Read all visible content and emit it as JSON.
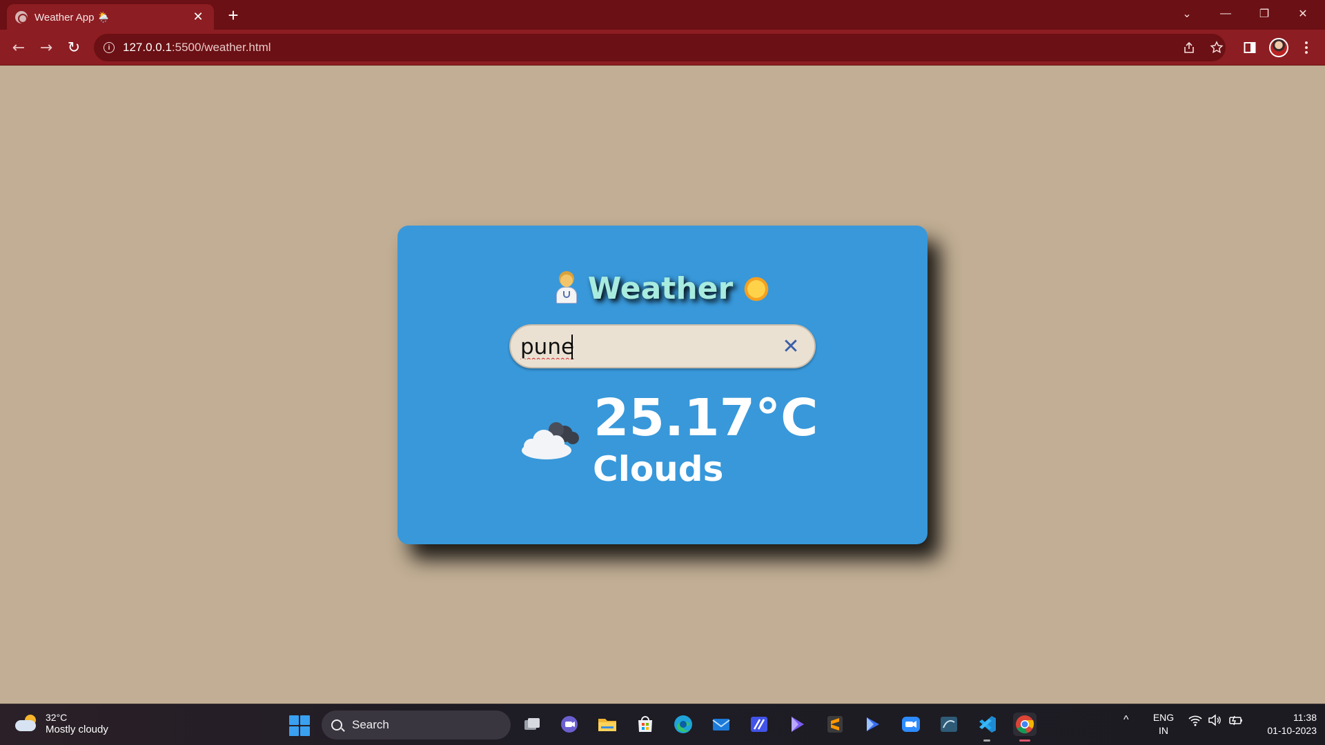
{
  "browser": {
    "tab_title": "Weather App 🌦️",
    "tab_close": "✕",
    "new_tab": "+",
    "url_host": "127.0.0.1",
    "url_path": ":5500/weather.html",
    "info_glyph": "i"
  },
  "window_controls": {
    "dropdown": "⌄",
    "minimize": "—",
    "restore": "❐",
    "close": "✕"
  },
  "nav": {
    "back": "←",
    "forward": "→",
    "reload": "↻"
  },
  "weather_app": {
    "title": "Weather",
    "search_value": "pune",
    "clear_glyph": "✕",
    "temperature": "25.17°C",
    "condition": "Clouds",
    "condition_icon": "cloud-icon"
  },
  "taskbar": {
    "weather_temp": "32°C",
    "weather_desc": "Mostly cloudy",
    "search_label": "Search",
    "lang_line1": "ENG",
    "lang_line2": "IN",
    "time": "11:38",
    "date": "01-10-2023",
    "tray_chevron": "^"
  },
  "colors": {
    "page_bg": "#c1ae94",
    "card_bg": "#3898da",
    "title_color": "#a8ebdf",
    "chrome_dark": "#6b1014",
    "chrome_toolbar": "#8c1d22"
  }
}
